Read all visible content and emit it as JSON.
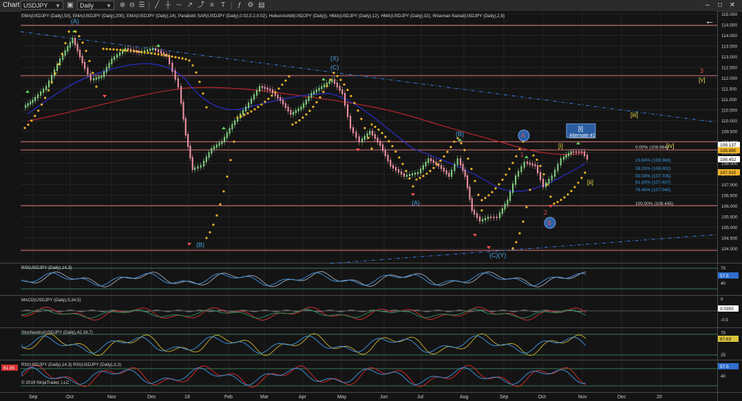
{
  "toolbar": {
    "title": "Chart",
    "instrument": "USDJPY",
    "period": "Daily"
  },
  "colors": {
    "background": "#141414",
    "sar": "#f0b429",
    "ema50": "#2a2fd0",
    "ema200": "#b8262b",
    "hline": "#e07a7a",
    "trend": "#3c7fe6",
    "wave": "#4aa3e0"
  },
  "main_panel": {
    "indicator_legend": "EMA(USDJPY (Daily),50), EMA(USDJPY (Daily),200), EMA(USDJPY (Daily),14), Parabolic SAR(USDJPY (Daily),0.02,0.2,0.02), HeikenAshi8(USDJPY (Daily)), HMA(USDJPY (Daily),12), HMA(USDJPY (Daily),32), Wiseman fractal(USDJPY (Daily),2,8)",
    "price_axis": [
      "115.000",
      "114.500",
      "114.000",
      "113.500",
      "113.000",
      "112.500",
      "112.000",
      "111.500",
      "111.000",
      "110.500",
      "110.000",
      "109.500",
      "109.000",
      "108.500",
      "108.000",
      "107.500",
      "107.000",
      "106.500",
      "106.000",
      "105.500",
      "105.000",
      "104.500",
      "104.000"
    ],
    "price_tags": [
      {
        "text": "109.137",
        "bg": "#ffffff",
        "fg": "#000000"
      },
      {
        "text": "108.880",
        "bg": "#f0b429",
        "fg": "#000000"
      },
      {
        "text": "108.452",
        "bg": "#ffffff",
        "fg": "#000000"
      },
      {
        "text": "107.915",
        "bg": "#f0b429",
        "fg": "#000000"
      }
    ],
    "wave_labels": [
      "(A)",
      "(B)",
      "(X)",
      "(C)",
      "(B)",
      "(A)",
      "(C)(Y)",
      "A",
      "B",
      "1",
      "2",
      "[i]",
      "Alternate #1",
      "[i]",
      "[iv]",
      "[ii]",
      "[iii]",
      "3",
      "[v]"
    ],
    "fib_levels": [
      "0.00% (108.964)",
      "23.60% (108.369)",
      "38.20% (108.002)",
      "50.00% (107.705)",
      "61.80% (107.407)",
      "76.40% (107.040)",
      "100.00% (106.445)"
    ],
    "back_arrow": "←"
  },
  "panels": [
    {
      "title": "RSI(USDJPY (Daily),14,3)",
      "axis": [
        "70",
        "57.5",
        "40"
      ],
      "tag": "57.5"
    },
    {
      "title": "MACD(USDJPY (Daily),5,34,5)",
      "axis": [
        "0",
        "0.0355",
        "-0.5"
      ],
      "tag": "0.0355"
    },
    {
      "title": "Stochastics(USDJPY (Daily),42,16,7)",
      "axis": [
        "75",
        "67.63",
        "25"
      ],
      "tag": "67.63"
    },
    {
      "title": "RSI(USDJPY (Daily),14,3) RSI(USDJPY (Daily),3,3)",
      "axis": [
        "57.5",
        "40"
      ],
      "tag": "57.5",
      "left_tag": "61.85"
    }
  ],
  "copyright": "© 2019 NinjaTrader, LLC",
  "x_axis": [
    "Sep",
    "Oct",
    "Nov",
    "Dec",
    "19",
    "Feb",
    "Mar",
    "Apr",
    "May",
    "Jun",
    "Jul",
    "Aug",
    "Sep",
    "Oct",
    "Nov",
    "Dec",
    "20"
  ]
}
